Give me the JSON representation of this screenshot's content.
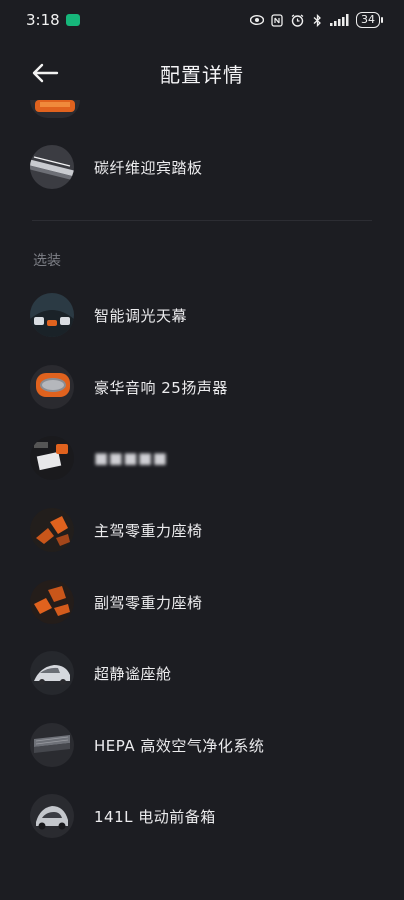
{
  "status_bar": {
    "time": "3:18",
    "battery": "34"
  },
  "header": {
    "title": "配置详情"
  },
  "standard_items": [
    {
      "label": "碳纤维迎宾踏板",
      "icon": "door-sill-thumbnail"
    }
  ],
  "optional_section": {
    "title": "选装",
    "items": [
      {
        "label": "智能调光天幕",
        "icon": "sunroof-thumbnail"
      },
      {
        "label": "豪华音响 25扬声器",
        "icon": "speaker-thumbnail"
      },
      {
        "label": "■■■■■",
        "icon": "blurred-option-thumbnail",
        "blurred": true
      },
      {
        "label": "主驾零重力座椅",
        "icon": "driver-seat-thumbnail"
      },
      {
        "label": "副驾零重力座椅",
        "icon": "passenger-seat-thumbnail"
      },
      {
        "label": "超静谧座舱",
        "icon": "quiet-cabin-thumbnail"
      },
      {
        "label": "HEPA 高效空气净化系统",
        "icon": "air-purifier-thumbnail"
      },
      {
        "label": "141L 电动前备箱",
        "icon": "front-trunk-thumbnail"
      }
    ]
  },
  "colors": {
    "background": "#1c1d22",
    "accent_orange": "#e0621e"
  }
}
